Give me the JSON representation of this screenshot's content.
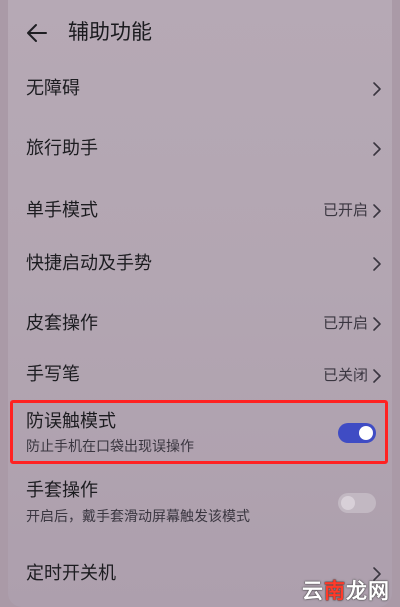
{
  "header": {
    "title": "辅助功能",
    "back_icon": "arrow-left-icon"
  },
  "items": [
    {
      "label": "无障碍"
    },
    {
      "label": "旅行助手"
    },
    {
      "label": "单手模式",
      "value": "已开启"
    },
    {
      "label": "快捷启动及手势"
    },
    {
      "label": "皮套操作",
      "value": "已开启"
    },
    {
      "label": "手写笔",
      "value": "已关闭"
    },
    {
      "label": "防误触模式",
      "subtitle": "防止手机在口袋出现误操作",
      "toggle": "on"
    },
    {
      "label": "手套操作",
      "subtitle": "开启后，戴手套滑动屏幕触发该模式",
      "toggle": "off"
    },
    {
      "label": "定时开关机"
    }
  ],
  "watermark": {
    "part1": "云",
    "part2": "南",
    "part3": "龙网"
  },
  "colors": {
    "toggle_on": "#3f4cc4",
    "toggle_off": "#c2b8c2",
    "highlight": "#ff2222",
    "background": "#b3a6b2"
  }
}
